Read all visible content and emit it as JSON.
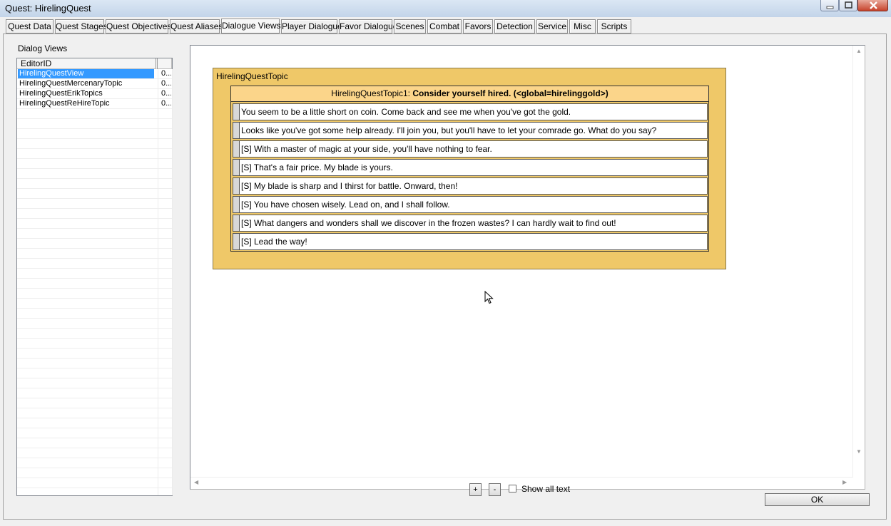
{
  "window": {
    "title": "Quest: HirelingQuest"
  },
  "tabs": [
    "Quest Data",
    "Quest Stages",
    "Quest Objectives",
    "Quest Aliases",
    "Dialogue Views",
    "Player Dialogue",
    "Favor Dialogue",
    "Scenes",
    "Combat",
    "Favors",
    "Detection",
    "Service",
    "Misc",
    "Scripts"
  ],
  "active_tab": "Dialogue Views",
  "dialog_views": {
    "label": "Dialog Views",
    "columns": [
      "EditorID",
      ""
    ],
    "rows": [
      {
        "id": "HirelingQuestView",
        "c2": "0...",
        "selected": true
      },
      {
        "id": "HirelingQuestMercenaryTopic",
        "c2": "0..."
      },
      {
        "id": "HirelingQuestErikTopics",
        "c2": "0..."
      },
      {
        "id": "HirelingQuestReHireTopic",
        "c2": "0..."
      }
    ]
  },
  "topic": {
    "group_title": "HirelingQuestTopic",
    "header_id": "HirelingQuestTopic1:",
    "header_text": "Consider yourself hired. (<global=hirelinggold>)",
    "responses": [
      "You seem to be a little short on coin. Come back and see me when you've got the gold.",
      "Looks like you've got some help already. I'll join you, but you'll have to let your comrade go. What do you say?",
      "[S] With a master of magic at your side, you'll have nothing to fear.",
      "[S] That's a fair price. My blade is yours.",
      "[S] My blade is sharp and I thirst for battle. Onward, then!",
      "[S] You have chosen wisely. Lead on, and I shall follow.",
      "[S] What dangers and wonders shall we discover in the frozen wastes? I can hardly wait to find out!",
      "[S] Lead the way!"
    ]
  },
  "controls": {
    "plus_label": "+",
    "minus_label": "-",
    "show_all_text_label": "Show all text",
    "show_all_text_checked": false,
    "ok_label": "OK"
  },
  "colors": {
    "topic_fill": "#efc868",
    "topic_header_fill": "#fbd58a",
    "selection": "#3399ff"
  }
}
